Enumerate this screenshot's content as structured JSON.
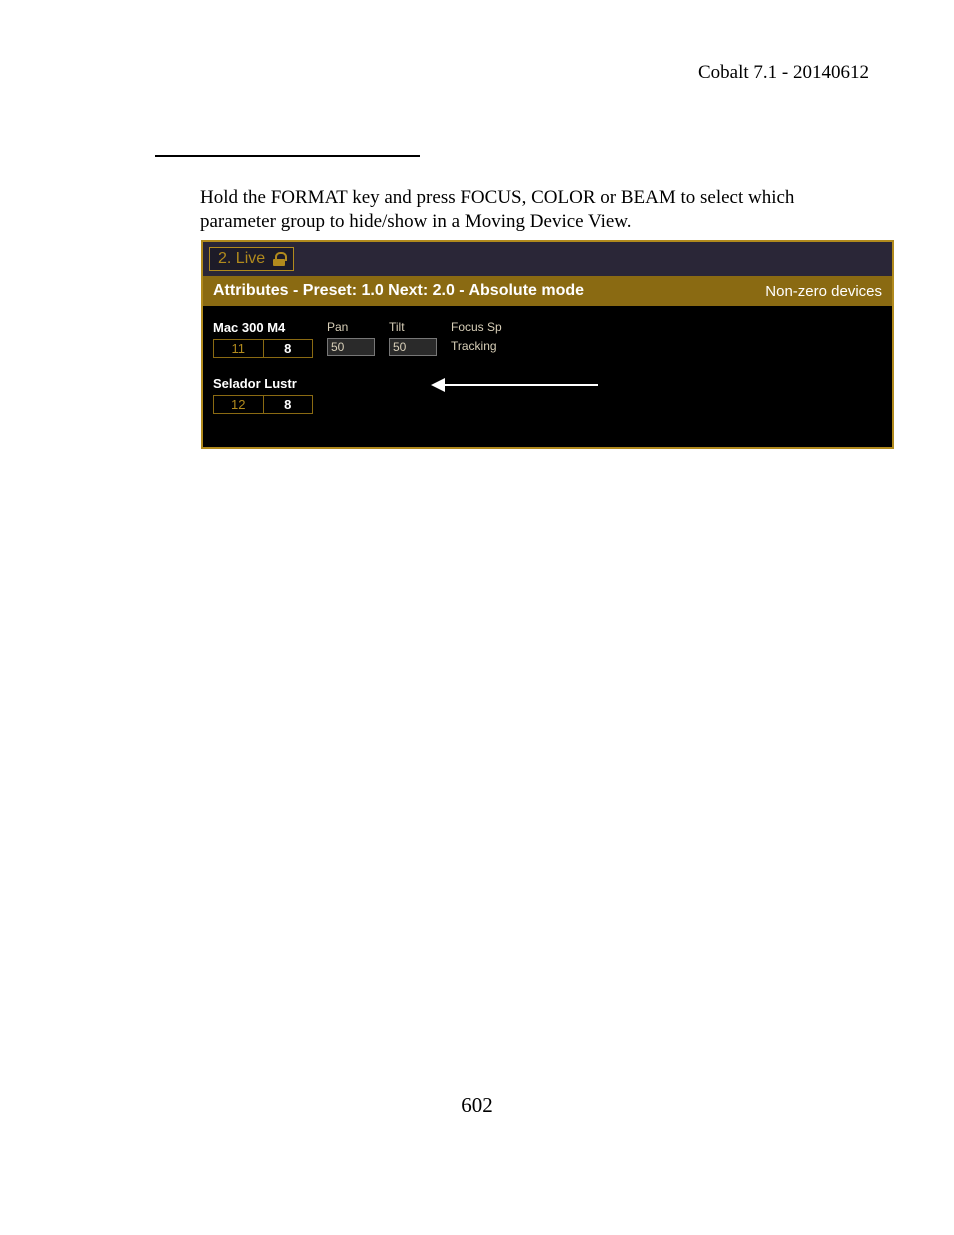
{
  "header": {
    "title": "Cobalt 7.1 - 20140612"
  },
  "body": {
    "paragraph": "Hold the FORMAT key and press FOCUS, COLOR or BEAM to select which parameter group to hide/show in a Moving Device View."
  },
  "footer": {
    "page_number": "602"
  },
  "ui": {
    "tab": {
      "label": "2. Live"
    },
    "status": {
      "left": "Attributes - Preset: 1.0 Next: 2.0 - Absolute mode",
      "right": "Non-zero devices"
    },
    "devices": [
      {
        "name": "Mac 300 M4",
        "chip_a": "11",
        "chip_b": "8",
        "params": [
          {
            "label": "Pan",
            "value": "50"
          },
          {
            "label": "Tilt",
            "value": "50"
          },
          {
            "label": "Focus Sp",
            "value": "Tracking"
          }
        ]
      },
      {
        "name": "Selador Lustr",
        "chip_a": "12",
        "chip_b": "8",
        "params": []
      }
    ]
  }
}
